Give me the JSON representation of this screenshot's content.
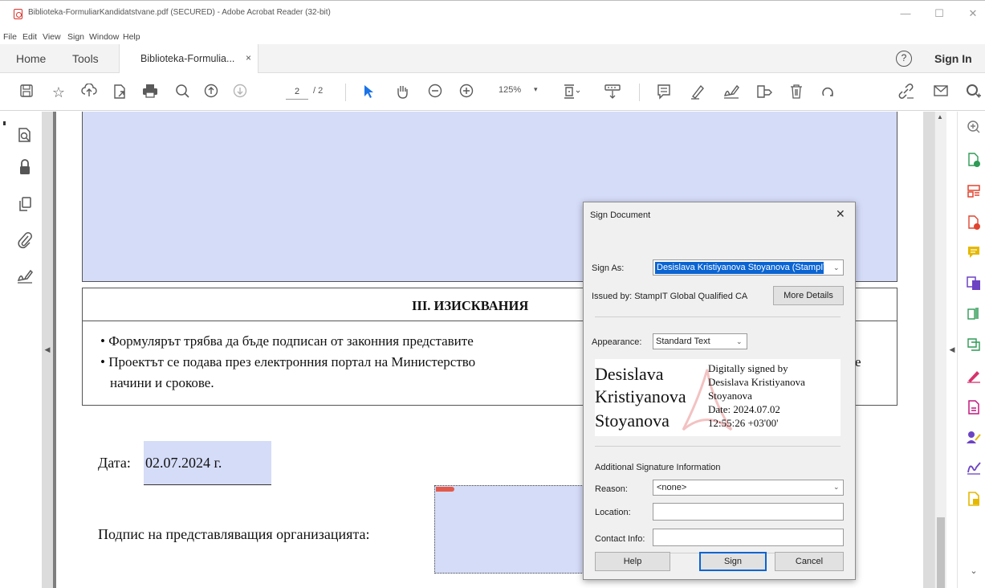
{
  "window": {
    "title": "Biblioteka-FormuliarKandidatstvane.pdf (SECURED) - Adobe Acrobat Reader (32-bit)",
    "minimize": "—",
    "maximize": "☐",
    "close": "✕"
  },
  "menu": [
    "File",
    "Edit",
    "View",
    "Sign",
    "Window",
    "Help"
  ],
  "tabs": {
    "home": "Home",
    "tools": "Tools",
    "document": "Biblioteka-Formulia...",
    "close": "×",
    "help": "?",
    "sign_in": "Sign In"
  },
  "toolbar": {
    "page_current": "2",
    "page_total": "/ 2",
    "zoom": "125%",
    "zoom_caret": "▾",
    "icons": [
      "save-icon",
      "bookmark-star-icon",
      "upload-cloud-icon",
      "file-share-icon",
      "print-icon",
      "zoom-search-icon",
      "page-up-icon",
      "page-down-icon",
      "select-arrow-icon",
      "hand-pan-icon",
      "zoom-out-icon",
      "zoom-in-icon",
      "fit-page-icon",
      "scroll-mode-icon",
      "comment-icon",
      "highlight-pen-icon",
      "sign-icon",
      "fill-form-icon",
      "delete-icon",
      "rotate-icon",
      "link-icon",
      "email-icon",
      "account-icon"
    ]
  },
  "document": {
    "section_heading": "III. ИЗИСКВАНИЯ",
    "line1": "• Формулярът трябва да бъде подписан от законния представите",
    "line2": "• Проектът се подава през електронния портал на Министерство",
    "line3": "начини и срокове.",
    "line2_tail": "е",
    "date_label": "Дата:",
    "date_value": "02.07.2024 г.",
    "signature_label": "Подпис на представляващия организацията:"
  },
  "dialog": {
    "title": "Sign Document",
    "close": "✕",
    "sign_as_label": "Sign As:",
    "sign_as_value": "Desislava Kristiyanova Stoyanova (StampIT",
    "issued_by": "Issued by: StampIT Global Qualified CA",
    "more_details": "More Details",
    "appearance_label": "Appearance:",
    "appearance_value": "Standard Text",
    "preview": {
      "name_lines": [
        "Desislava",
        "Kristiyanova",
        "Stoyanova"
      ],
      "detail_lines": [
        "Digitally signed by",
        "Desislava Kristiyanova",
        "Stoyanova",
        "Date: 2024.07.02",
        "12:55:26 +03'00'"
      ]
    },
    "additional_info": "Additional Signature Information",
    "reason_label": "Reason:",
    "reason_value": "<none>",
    "location_label": "Location:",
    "location_value": "",
    "contact_label": "Contact Info:",
    "contact_value": "",
    "help": "Help",
    "sign": "Sign",
    "cancel": "Cancel"
  },
  "colors": {
    "form_fill": "#d5dcf8",
    "selection": "#0a64d2",
    "accent_blue": "#1a73e8",
    "right_rail_icons": [
      "#7a7a7a",
      "#2e9a55",
      "#e0442f",
      "#e0442f",
      "#e5b800",
      "#6b43c3",
      "#2e9a55",
      "#2e9a55",
      "#d6336c",
      "#c2187f",
      "#6b43c3",
      "#6b43c3",
      "#e5b800"
    ]
  }
}
